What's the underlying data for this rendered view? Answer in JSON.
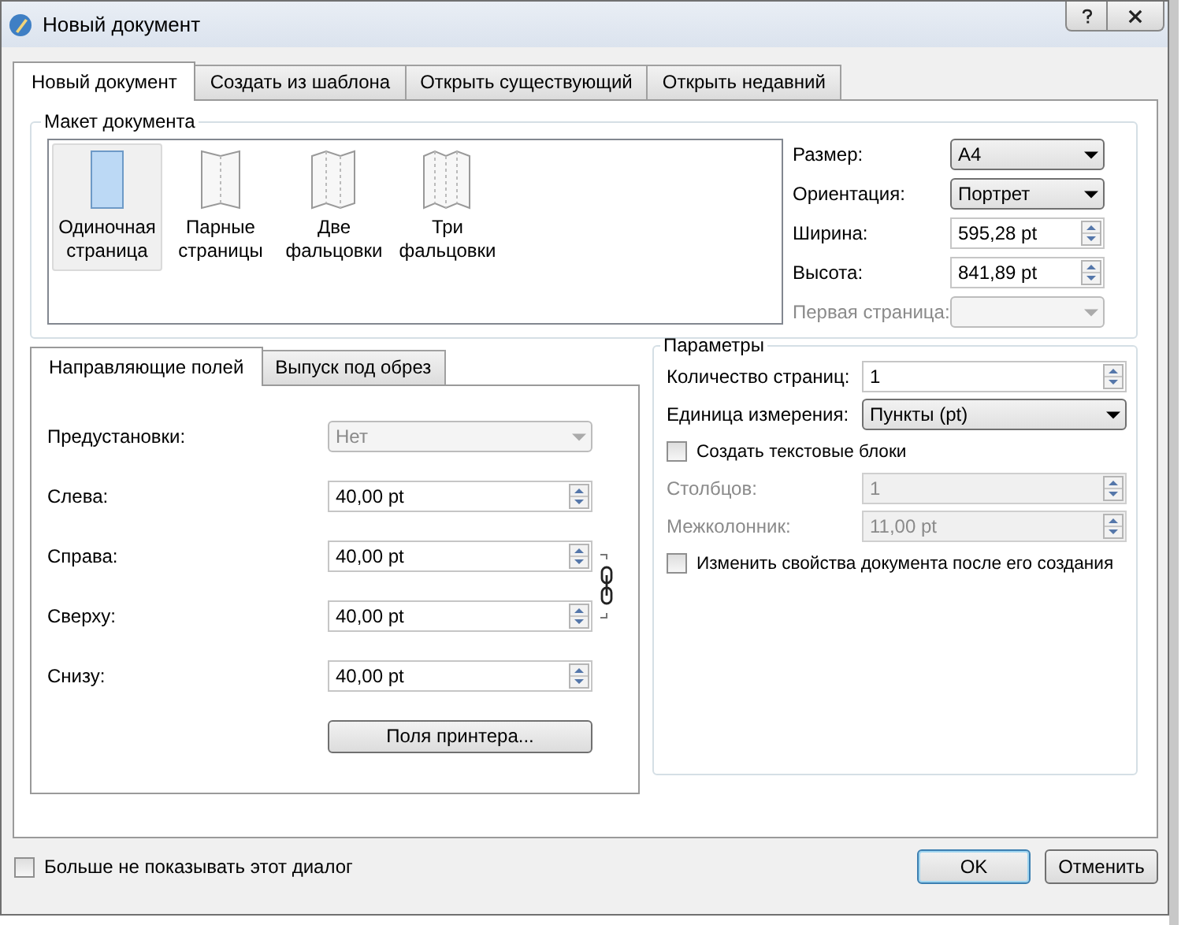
{
  "window": {
    "title": "Новый документ"
  },
  "tabs": [
    {
      "label": "Новый документ",
      "selected": true
    },
    {
      "label": "Создать из шаблона",
      "selected": false
    },
    {
      "label": "Открыть существующий",
      "selected": false
    },
    {
      "label": "Открыть недавний",
      "selected": false
    }
  ],
  "layout_group": {
    "title": "Макет документа",
    "layouts": [
      {
        "kind": "single",
        "label": "Одиночная страница",
        "selected": true
      },
      {
        "kind": "facing",
        "label": "Парные страницы",
        "selected": false
      },
      {
        "kind": "bifold",
        "label": "Две фальцовки",
        "selected": false
      },
      {
        "kind": "trifold",
        "label": "Три фальцовки",
        "selected": false
      }
    ],
    "fields": [
      {
        "kind": "select",
        "label": "Размер:",
        "value": "A4",
        "disabled": false
      },
      {
        "kind": "select",
        "label": "Ориентация:",
        "value": "Портрет",
        "disabled": false
      },
      {
        "kind": "spin",
        "label": "Ширина:",
        "value": "595,28  pt",
        "disabled": false
      },
      {
        "kind": "spin",
        "label": "Высота:",
        "value": "841,89  pt",
        "disabled": false
      },
      {
        "kind": "select",
        "label": "Первая страница:",
        "disabled": true
      }
    ]
  },
  "margins": {
    "tabs": [
      {
        "label": "Направляющие полей",
        "selected": true
      },
      {
        "label": "Выпуск под обрез",
        "selected": false
      }
    ],
    "rows": [
      {
        "kind": "select",
        "label": "Предустановки:",
        "value": "Нет",
        "disabled": true
      },
      {
        "kind": "spin",
        "label": "Слева:",
        "value": "40,00  pt",
        "disabled": false
      },
      {
        "kind": "spin",
        "label": "Справа:",
        "value": "40,00  pt",
        "disabled": false
      },
      {
        "kind": "spin",
        "label": "Сверху:",
        "value": "40,00  pt",
        "disabled": false
      },
      {
        "kind": "spin",
        "label": "Снизу:",
        "value": "40,00  pt",
        "disabled": false
      }
    ],
    "linked": true,
    "button": "Поля принтера..."
  },
  "params": {
    "title": "Параметры",
    "rows": [
      {
        "kind": "spin",
        "label": "Количество страниц:",
        "value": "1",
        "disabled": false
      },
      {
        "kind": "select",
        "label": "Единица измерения:",
        "value": "Пункты (pt)",
        "disabled": false
      },
      {
        "kind": "checkbox",
        "label": "Создать текстовые блоки",
        "checked": false
      },
      {
        "kind": "spin",
        "label": "Столбцов:",
        "value": "1",
        "disabled": true
      },
      {
        "kind": "spin",
        "label": "Межколонник:",
        "value": "11,00  pt",
        "disabled": true
      },
      {
        "kind": "checkbox",
        "label": "Изменить свойства документа после его создания",
        "checked": false
      }
    ]
  },
  "footer": {
    "checkbox": {
      "label": "Больше не показывать этот диалог",
      "checked": false
    },
    "buttons": [
      {
        "label": "OK",
        "default": true
      },
      {
        "label": "Отменить",
        "default": false
      }
    ]
  }
}
